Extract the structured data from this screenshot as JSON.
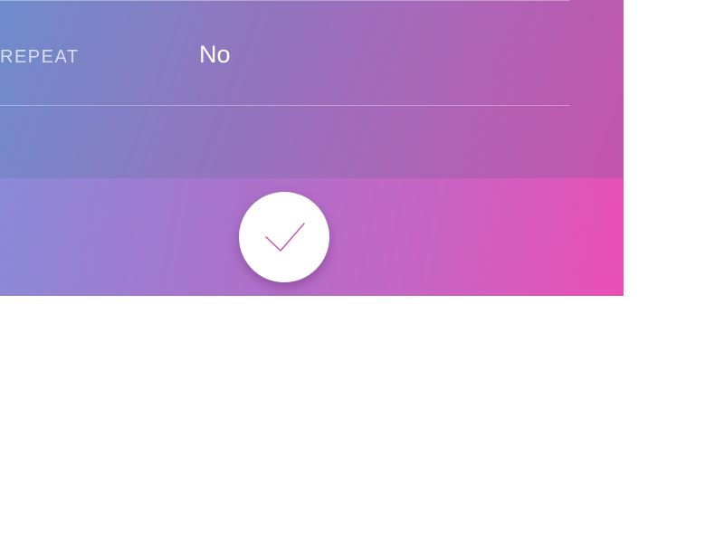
{
  "repeat_row": {
    "label": "REPEAT",
    "value": "No"
  },
  "confirm": {
    "icon": "check-icon",
    "check_color": "#c44fbf"
  },
  "colors": {
    "top_gradient_start": "#6f8ccc",
    "top_gradient_end": "#c454ae",
    "bottom_gradient_start": "#8a8ad8",
    "bottom_gradient_end": "#ea4eb6"
  }
}
